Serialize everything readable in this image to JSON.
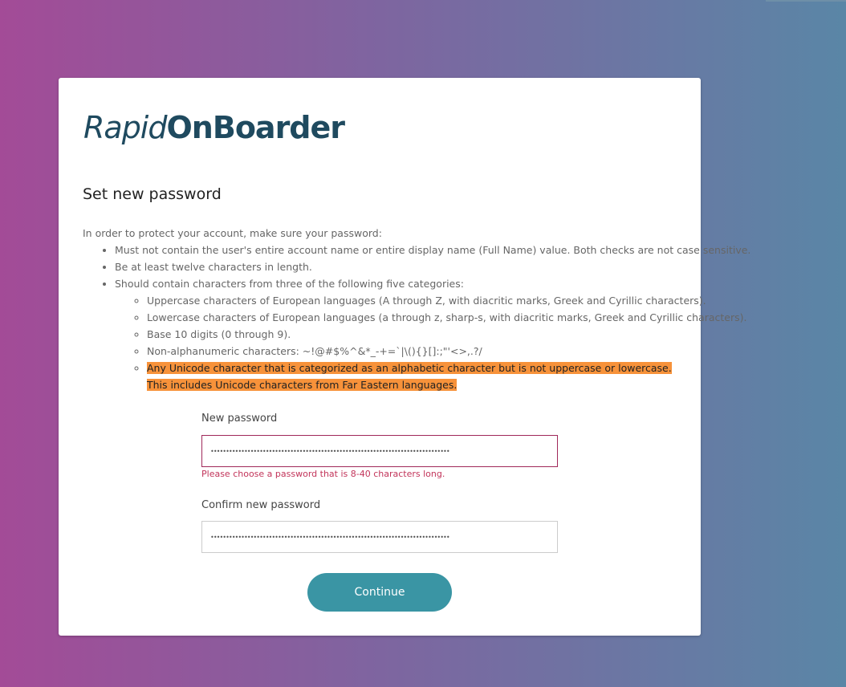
{
  "logo": {
    "part1": "Rapid",
    "part2": "OnBoarder"
  },
  "page_title": "Set new password",
  "instructions": {
    "intro": "In order to protect your account, make sure your password:",
    "rules": [
      "Must not contain the user's entire account name or entire display name (Full Name) value. Both checks are not case sensitive.",
      "Be at least twelve characters in length.",
      "Should contain characters from three of the following five categories:"
    ],
    "categories": [
      "Uppercase characters of European languages (A through Z, with diacritic marks, Greek and Cyrillic characters).",
      "Lowercase characters of European languages (a through z, sharp-s, with diacritic marks, Greek and Cyrillic characters).",
      "Base 10 digits (0 through 9).",
      "Non-alphanumeric characters: ~!@#$%^&*_-+=`|\\(){}[]:;\"'<>,.?/",
      "Any Unicode character that is categorized as an alphabetic character but is not uppercase or lowercase. This includes Unicode characters from Far Eastern languages."
    ]
  },
  "form": {
    "new_password_label": "New password",
    "new_password_value": "••••••••••••••••••••••••••••••••••••••••••••••••••••••••••••••••••••••••••••••",
    "error_message": "Please choose a password that is 8-40 characters long.",
    "confirm_password_label": "Confirm new password",
    "confirm_password_value": "••••••••••••••••••••••••••••••••••••••••••••••••••••••••••••••••••••••••••••••",
    "continue_label": "Continue"
  },
  "colors": {
    "accent": "#3a95a4",
    "brand": "#1f4a5f",
    "error": "#c2345a",
    "highlight": "#f7923a"
  }
}
